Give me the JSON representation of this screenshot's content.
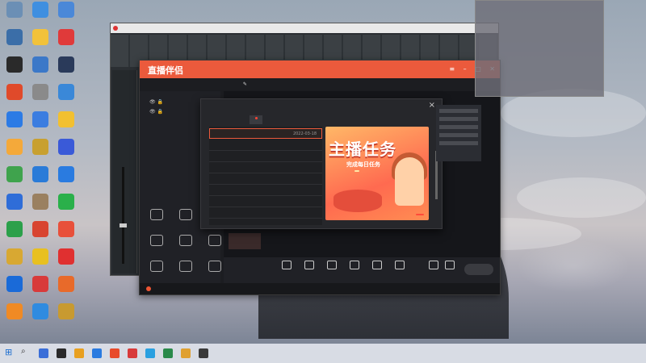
{
  "desktop": {
    "icons": [
      {
        "label": "",
        "color": "#6b8fb5"
      },
      {
        "label": "",
        "color": "#3b6ea8"
      },
      {
        "label": "",
        "color": "#2a2a2a"
      },
      {
        "label": "",
        "color": "#e04a2a"
      },
      {
        "label": "",
        "color": "#2c7be5"
      },
      {
        "label": "",
        "color": "#f4a93a"
      },
      {
        "label": "",
        "color": "#3fa34d"
      },
      {
        "label": "",
        "color": "#2f6dd8"
      },
      {
        "label": "",
        "color": "#2ca04a"
      },
      {
        "label": "",
        "color": "#d8a832"
      },
      {
        "label": "",
        "color": "#1a6ad8"
      },
      {
        "label": "",
        "color": "#f08a24"
      },
      {
        "label": "",
        "color": "#3f8fe0"
      },
      {
        "label": "",
        "color": "#f2c23a"
      },
      {
        "label": "",
        "color": "#3b78c8"
      },
      {
        "label": "",
        "color": "#8a8a8a"
      },
      {
        "label": "",
        "color": "#3b7de0"
      },
      {
        "label": "",
        "color": "#c8a030"
      },
      {
        "label": "",
        "color": "#2a7bd8"
      },
      {
        "label": "",
        "color": "#9a8060"
      },
      {
        "label": "",
        "color": "#d84430"
      },
      {
        "label": "",
        "color": "#e8c020"
      },
      {
        "label": "",
        "color": "#d83a3a"
      },
      {
        "label": "",
        "color": "#2f8be0"
      },
      {
        "label": "",
        "color": "#4a88d8"
      },
      {
        "label": "",
        "color": "#e03a3a"
      },
      {
        "label": "",
        "color": "#2a3a5a"
      },
      {
        "label": "",
        "color": "#3a88d8"
      },
      {
        "label": "",
        "color": "#f2c030"
      },
      {
        "label": "",
        "color": "#3a5ad8"
      },
      {
        "label": "",
        "color": "#2a7be0"
      },
      {
        "label": "",
        "color": "#2ab04a"
      },
      {
        "label": "",
        "color": "#e8503a"
      },
      {
        "label": "",
        "color": "#e03030"
      },
      {
        "label": "",
        "color": "#e86a2a"
      },
      {
        "label": "",
        "color": "#c89a30"
      }
    ]
  },
  "mixer": {
    "title": ""
  },
  "app": {
    "logo": "直播伴侣",
    "badge": "",
    "tabs": [
      "",
      "",
      "",
      ""
    ],
    "scene_tab": "",
    "scene_pill": "",
    "scene_hint": "",
    "left_rows": [
      "",
      ""
    ],
    "toolbox_title": "",
    "tools_row1": [
      "",
      ""
    ],
    "tools_row2": [
      "",
      ""
    ],
    "tools_row3": [
      "",
      "",
      ""
    ],
    "tools_row4": [
      "",
      "",
      ""
    ],
    "bottom_buttons": [
      "",
      "",
      "",
      "",
      "",
      ""
    ],
    "go_live": "",
    "status": ""
  },
  "message_center": {
    "title": "",
    "tabs": [
      "",
      ""
    ],
    "rows": [
      {
        "title": "",
        "date": "2022-03-18"
      }
    ],
    "banner": {
      "title": "主播任务",
      "subtitle": "完成每日任务",
      "tag": "",
      "cta": ""
    }
  },
  "popup": {
    "lines": [
      "",
      "",
      "",
      "",
      "",
      "",
      ""
    ]
  },
  "taskbar": {
    "weather": "",
    "time": "",
    "date": "",
    "icon_colors": [
      "#3a6ed8",
      "#2a2a2a",
      "#e8a020",
      "#2a7be0",
      "#e84a2a",
      "#d83a3a",
      "#2aa0e0",
      "#2a8a4a",
      "#e0a030",
      "#3a3a3a"
    ]
  },
  "watermark": {
    "line1": "",
    "line2": ""
  }
}
